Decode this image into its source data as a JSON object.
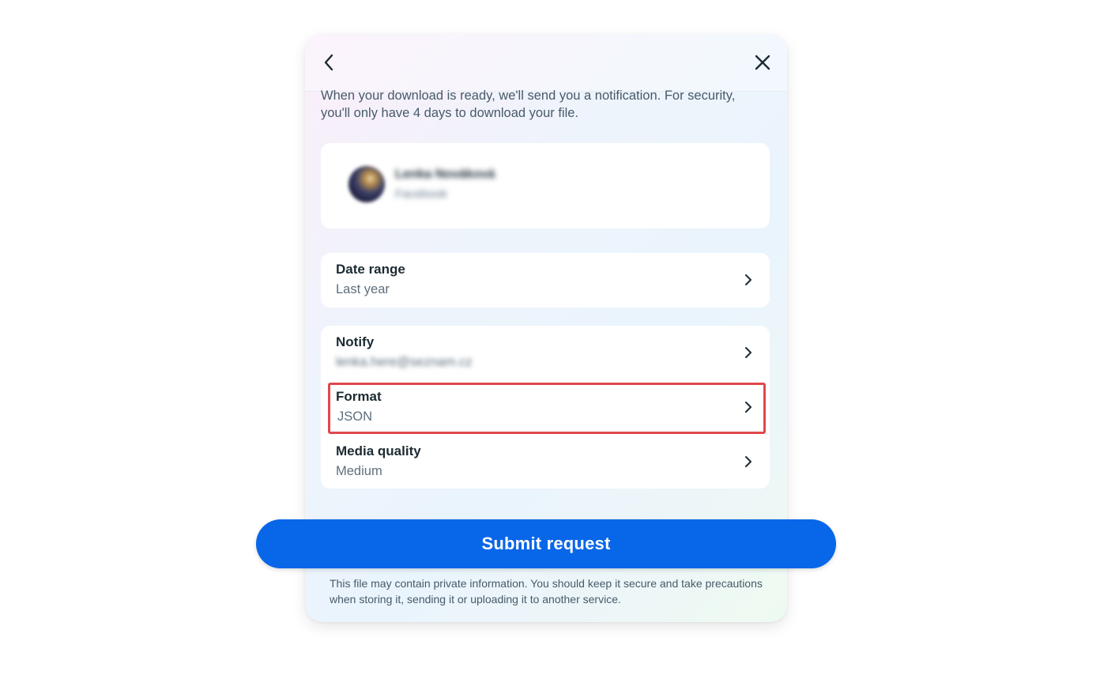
{
  "dialog": {
    "intro_text": "When your download is ready, we'll send you a notification. For security, you'll only have 4 days to download your file.",
    "account": {
      "name": "Lenka Nováková",
      "platform": "Facebook"
    },
    "date_range": {
      "title": "Date range",
      "value": "Last year"
    },
    "settings": [
      {
        "title": "Notify",
        "value": "lenka.here@seznam.cz"
      },
      {
        "title": "Format",
        "value": "JSON"
      },
      {
        "title": "Media quality",
        "value": "Medium"
      }
    ],
    "submit_label": "Submit request",
    "disclaimer": "This file may contain private information. You should keep it secure and take precautions when storing it, sending it or uploading it to another service."
  },
  "colors": {
    "primary_button": "#0866e8",
    "highlight_border": "#e0474c",
    "title_text": "#1c2b33",
    "secondary_text": "#5e6f7d"
  },
  "icons": {
    "back": "chevron-left-icon",
    "close": "close-icon",
    "row_chevron": "chevron-right-icon"
  }
}
